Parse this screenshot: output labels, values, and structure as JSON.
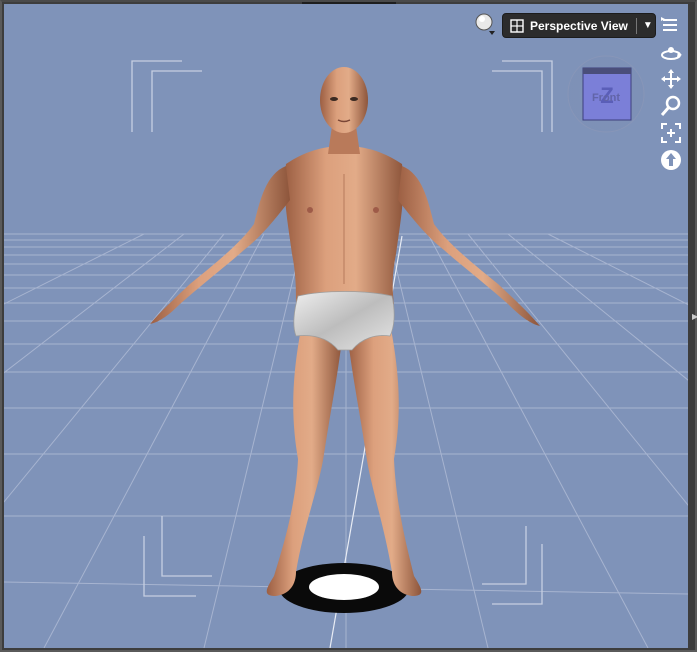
{
  "viewport": {
    "title": "Perspective View",
    "background_color": "#7f93b9",
    "grid_color": "#aab6d1"
  },
  "toolbar": {
    "shading_icon": "sphere-icon",
    "view_selector_label": "Perspective View",
    "view_selector_icon": "grid-icon",
    "menu_icon": "pane-menu-icon"
  },
  "camera_tools": [
    {
      "name": "orbit-icon"
    },
    {
      "name": "pan-icon"
    },
    {
      "name": "zoom-icon"
    },
    {
      "name": "frame-icon"
    },
    {
      "name": "reset-view-icon"
    }
  ],
  "view_cube": {
    "face_label": "Front",
    "axis_label": "Z"
  },
  "figure": {
    "skin_color": "#c98a68",
    "garment_color": "#d9d9d9"
  }
}
